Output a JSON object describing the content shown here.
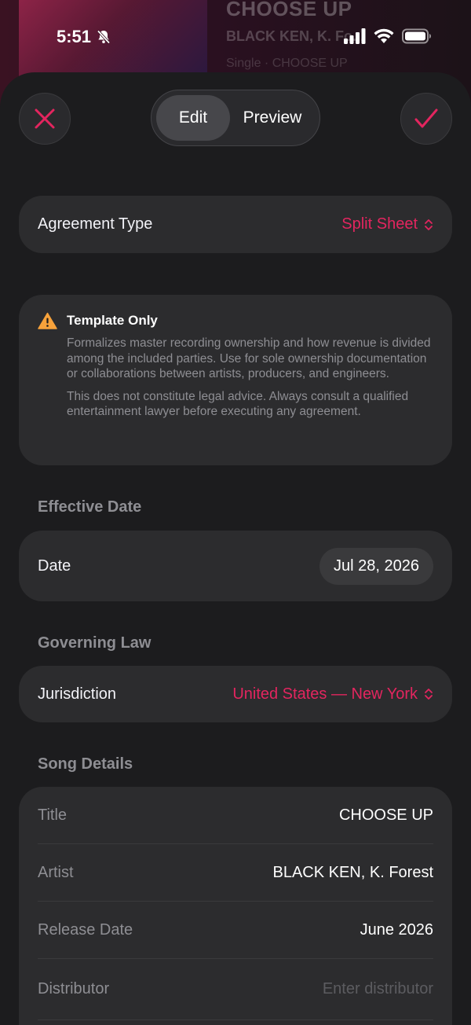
{
  "background": {
    "track_title": "CHOOSE UP",
    "track_artist": "BLACK KEN, K. Fo...",
    "track_meta": "Single · CHOOSE UP"
  },
  "status_bar": {
    "time": "5:51",
    "icons": [
      "bell-slash-icon",
      "cellular-signal-icon",
      "wifi-icon",
      "battery-icon"
    ]
  },
  "header": {
    "segments": {
      "edit": "Edit",
      "preview": "Preview",
      "selected": "edit"
    },
    "close_icon": "close-icon",
    "done_icon": "checkmark-icon"
  },
  "agreement": {
    "label": "Agreement Type",
    "value": "Split Sheet"
  },
  "notice": {
    "title": "Template Only",
    "body": "Formalizes master recording ownership and how revenue is divided among the included parties. Use for sole ownership documentation or collaborations between artists, producers, and engineers.",
    "disclaimer": "This does not constitute legal advice. Always consult a qualified entertainment lawyer before executing any agreement."
  },
  "effective_date": {
    "section_title": "Effective Date",
    "label": "Date",
    "value": "Jul 28, 2026"
  },
  "governing_law": {
    "section_title": "Governing Law",
    "label": "Jurisdiction",
    "value": "United States — New York"
  },
  "song_details": {
    "section_title": "Song Details",
    "rows": [
      {
        "label": "Title",
        "value": "CHOOSE UP"
      },
      {
        "label": "Artist",
        "value": "BLACK KEN, K. Forest"
      },
      {
        "label": "Release Date",
        "value": "June 2026"
      },
      {
        "label": "Distributor",
        "value": "",
        "placeholder": "Enter distributor"
      }
    ]
  },
  "colors": {
    "accent": "#e3255f",
    "background": "#1c1c1e",
    "card": "#2c2c2e",
    "warning": "#f7a23b"
  }
}
